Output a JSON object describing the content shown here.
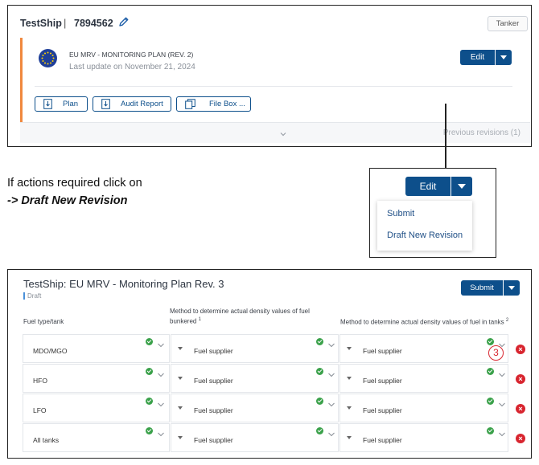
{
  "panel_top": {
    "ship_name": "TestShip",
    "separator": "|",
    "ship_id": "7894562",
    "vessel_type": "Tanker",
    "plan_title": "EU MRV - MONITORING PLAN (REV. 2)",
    "last_update": "Last update on November 21, 2024",
    "edit_label": "Edit",
    "actions": [
      {
        "label": "Plan",
        "icon": "document-download-icon"
      },
      {
        "label": "Audit Report",
        "icon": "document-download-icon"
      },
      {
        "label": "File Box ...",
        "icon": "files-icon"
      }
    ],
    "previous_revisions": "Previous revisions (1)"
  },
  "instruction": {
    "line1": "If actions required click on",
    "line2": "-> Draft New Revision"
  },
  "dropdown_zoom": {
    "edit_label": "Edit",
    "menu_items": [
      "Submit",
      "Draft New Revision"
    ]
  },
  "panel_bottom": {
    "title": "TestShip: EU MRV - Monitoring Plan Rev. 3",
    "status": "Draft",
    "submit_label": "Submit",
    "columns": {
      "fuel": "Fuel type/tank",
      "bunkered": "Method to determine actual density values of fuel bunkered",
      "bunkered_note": "1",
      "tanks": "Method to determine actual density values of fuel in tanks",
      "tanks_note": "2"
    },
    "rows": [
      {
        "fuel": "MDO/MGO",
        "bunkered": "Fuel supplier",
        "tanks": "Fuel supplier"
      },
      {
        "fuel": "HFO",
        "bunkered": "Fuel supplier",
        "tanks": "Fuel supplier"
      },
      {
        "fuel": "LFO",
        "bunkered": "Fuel supplier",
        "tanks": "Fuel supplier"
      },
      {
        "fuel": "All tanks",
        "bunkered": "Fuel supplier",
        "tanks": "Fuel supplier"
      }
    ],
    "callout_number": "3",
    "delete_symbol": "×"
  },
  "colors": {
    "primary": "#0d4f8b",
    "accent_orange": "#f0883e",
    "status_green": "#3aa14a",
    "delete_red": "#d8252f",
    "eu_blue": "#1f3f99"
  }
}
